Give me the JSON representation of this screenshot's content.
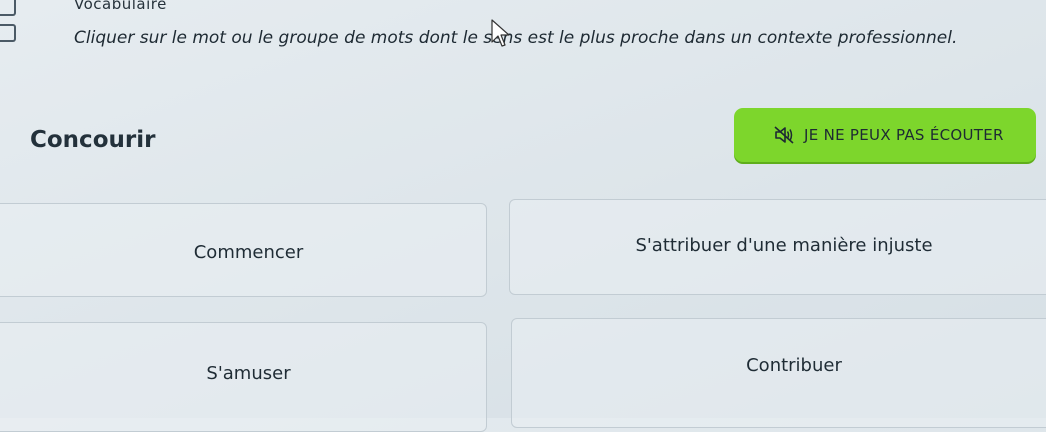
{
  "header": {
    "section_title": "Vocabulaire",
    "instructions": "Cliquer sur le mot ou le groupe de mots dont le sens est le plus proche dans un contexte professionnel."
  },
  "question": {
    "target_word": "Concourir"
  },
  "listen_button": {
    "label": "JE NE PEUX PAS ÉCOUTER",
    "icon": "speaker-muted-icon",
    "color": "#7dd62c"
  },
  "choices": [
    {
      "label": "Commencer"
    },
    {
      "label": "S'attribuer d'une manière injuste"
    },
    {
      "label": "S'amuser"
    },
    {
      "label": "Contribuer"
    }
  ]
}
